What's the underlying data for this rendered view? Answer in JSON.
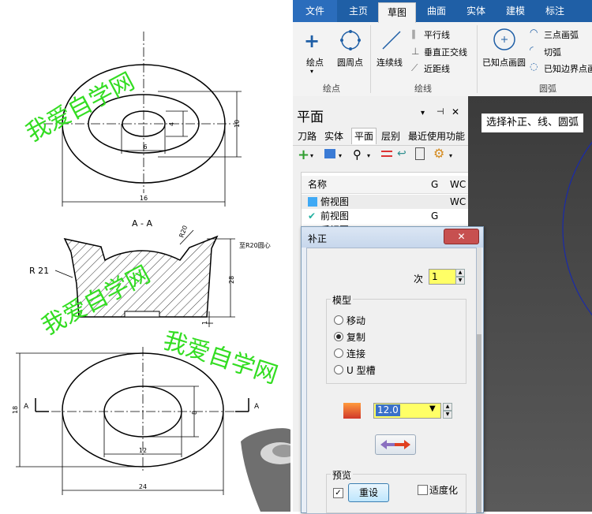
{
  "ribbon": {
    "tabs": [
      "文件",
      "主页",
      "草图",
      "曲面",
      "实体",
      "建模",
      "标注"
    ],
    "active_tab": "草图",
    "tools": {
      "point": "绘点",
      "circle_point": "圆周点",
      "polyline": "连续线",
      "parallel": "平行线",
      "perpendicular": "垂直正交线",
      "closest": "近距线",
      "known_circle": "已知点画圆",
      "three_point_arc": "三点画弧",
      "tangent_arc": "切弧",
      "edge_circle": "已知边界点画"
    },
    "groups": {
      "points": "绘点",
      "lines": "绘线",
      "arcs": "圆弧"
    }
  },
  "panel": {
    "title": "平面",
    "tabs": [
      "刀路",
      "实体",
      "平面",
      "层别",
      "最近使用功能"
    ],
    "active_tab": "平面",
    "columns": [
      "名称",
      "G",
      "WC"
    ],
    "rows": [
      {
        "name": "俯视图",
        "g": "",
        "wc": "WC",
        "icon_color": "#3fa9f5"
      },
      {
        "name": "前视图",
        "g": "G",
        "wc": "",
        "icon_color": "#21b0a0"
      },
      {
        "name": "后视图",
        "g": "",
        "wc": "",
        "icon_color": "#9b9b9b"
      }
    ]
  },
  "viewport": {
    "prompt": "选择补正、线、圆弧"
  },
  "dialog": {
    "title": "补正",
    "times_label": "次",
    "times_value": "1",
    "mode_group": "模型",
    "modes": [
      "移动",
      "复制",
      "连接",
      "U 型槽"
    ],
    "selected_mode": "复制",
    "distance": "12.0",
    "preview_group": "预览",
    "reset_button": "重设",
    "fit_label": "适度化",
    "reset_checked": true,
    "fit_checked": false
  },
  "drawing": {
    "watermark": "我爱自学网",
    "section_label": "A - A",
    "r21": "R 21",
    "r20": "R20",
    "r20_center": "至R20圆心",
    "dims": {
      "d4": "4",
      "d6": "6",
      "d10": "10",
      "d16": "16",
      "d28": "28",
      "d1": "1",
      "d18": "18",
      "d8": "8",
      "d12": "12",
      "d24": "24",
      "a": "A"
    }
  },
  "colors": {
    "ribbon_blue": "#1f5fa6",
    "watermark": "#33dd22",
    "highlight": "#ffff66",
    "circle": "#1a2aa8"
  }
}
